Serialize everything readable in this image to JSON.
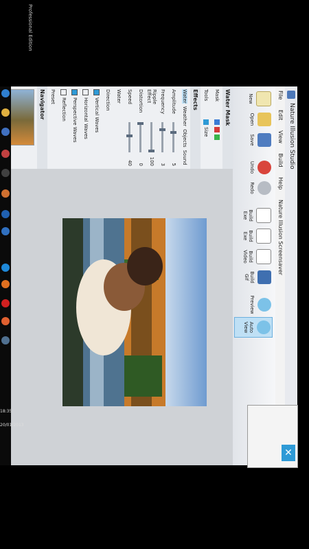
{
  "window": {
    "title": "Nature Illusion Studio",
    "menu": [
      "File",
      "Edit",
      "View",
      "Build",
      "Help",
      "Nature Illusion Screensaver"
    ]
  },
  "ribbon": {
    "buttons": [
      {
        "label": "New",
        "icon": "new-icon"
      },
      {
        "label": "Open",
        "icon": "folder-icon"
      },
      {
        "label": "Save",
        "icon": "save-icon"
      },
      {
        "label": "Undo",
        "icon": "undo-icon"
      },
      {
        "label": "Redo",
        "icon": "redo-icon"
      },
      {
        "label": "Build Exe",
        "icon": "build-exe-icon"
      },
      {
        "label": "Build Exe",
        "icon": "build-exe2-icon"
      },
      {
        "label": "Build Video",
        "icon": "video-icon"
      },
      {
        "label": "Build Gif",
        "icon": "gif-icon"
      },
      {
        "label": "Preview",
        "icon": "preview-icon"
      },
      {
        "label": "Auto View",
        "icon": "auto-view-icon"
      }
    ]
  },
  "water_mask": {
    "title": "Water Mask",
    "mask_label": "Mask",
    "tools_label": "Tools",
    "size_label": "Size",
    "line_label": "Line"
  },
  "effects": {
    "title": "Effects",
    "tabs": [
      "Water",
      "Weather",
      "Objects",
      "Sound"
    ],
    "sliders": [
      {
        "label": "Amplitude",
        "value": "5"
      },
      {
        "label": "Frequency",
        "value": "3"
      },
      {
        "label": "Ripple Effect",
        "value": "100"
      },
      {
        "label": "Distortion",
        "value": "0"
      },
      {
        "label": "Speed",
        "value": "40"
      },
      {
        "label": "Water",
        "value": ""
      },
      {
        "label": "Direction",
        "value": ""
      }
    ],
    "checks": [
      "Vertical Waves",
      "Horizontal Waves",
      "Perspective Waves",
      "Reflection"
    ],
    "preset_label": "Preset"
  },
  "navigator": {
    "title": "Navigator"
  },
  "taskbar": {
    "edition": "Professional Edition",
    "time": "18:35",
    "date": "20/01/2013"
  },
  "colors": {
    "ribbon": "#e6e9ee",
    "accent": "#2e9ad6",
    "panel": "#eef0f3"
  }
}
